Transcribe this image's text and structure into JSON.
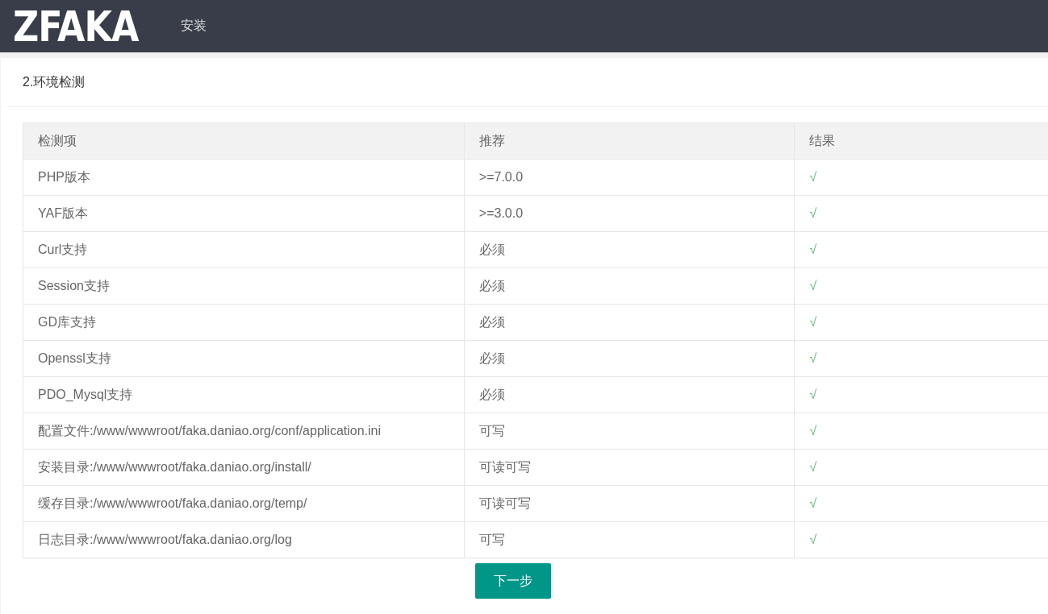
{
  "header": {
    "logo": "ZFAKA",
    "nav": [
      {
        "label": "安装"
      }
    ]
  },
  "card": {
    "title": "2.环境检测"
  },
  "table": {
    "columns": [
      "检测项",
      "推荐",
      "结果"
    ],
    "rows": [
      [
        "PHP版本",
        ">=7.0.0",
        "√"
      ],
      [
        "YAF版本",
        ">=3.0.0",
        "√"
      ],
      [
        "Curl支持",
        "必须",
        "√"
      ],
      [
        "Session支持",
        "必须",
        "√"
      ],
      [
        "GD库支持",
        "必须",
        "√"
      ],
      [
        "Openssl支持",
        "必须",
        "√"
      ],
      [
        "PDO_Mysql支持",
        "必须",
        "√"
      ],
      [
        "配置文件:/www/wwwroot/faka.daniao.org/conf/application.ini",
        "可写",
        "√"
      ],
      [
        "安装目录:/www/wwwroot/faka.daniao.org/install/",
        "可读可写",
        "√"
      ],
      [
        "缓存目录:/www/wwwroot/faka.daniao.org/temp/",
        "可读可写",
        "√"
      ],
      [
        "日志目录:/www/wwwroot/faka.daniao.org/log",
        "可写",
        "√"
      ]
    ]
  },
  "button": "下一步"
}
